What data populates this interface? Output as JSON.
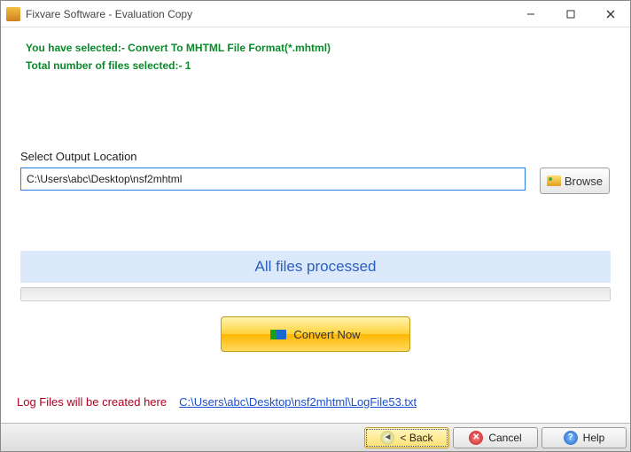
{
  "window": {
    "title": "Fixvare Software - Evaluation Copy"
  },
  "info": {
    "line1": "You have selected:- Convert To MHTML File Format(*.mhtml)",
    "line2": "Total number of files selected:- 1"
  },
  "output": {
    "label": "Select Output Location",
    "path": "C:\\Users\\abc\\Desktop\\nsf2mhtml",
    "browse": "Browse"
  },
  "status": {
    "text": "All files processed"
  },
  "convert": {
    "label": "Convert Now"
  },
  "footer": {
    "label": "Log Files will be created here",
    "link": "C:\\Users\\abc\\Desktop\\nsf2mhtml\\LogFile53.txt"
  },
  "buttons": {
    "back": "< Back",
    "cancel": "Cancel",
    "help": "Help"
  }
}
